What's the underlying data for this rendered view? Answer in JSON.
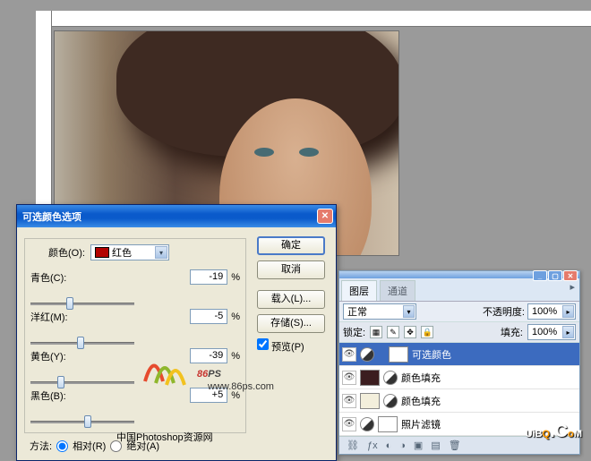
{
  "dialog": {
    "title": "可选颜色选项",
    "color_label": "颜色(O):",
    "color_name": "红色",
    "sliders": [
      {
        "label": "青色(C):",
        "value": "-19",
        "thumb": 40
      },
      {
        "label": "洋红(M):",
        "value": "-5",
        "thumb": 52
      },
      {
        "label": "黄色(Y):",
        "value": "-39",
        "thumb": 30
      },
      {
        "label": "黑色(B):",
        "value": "+5",
        "thumb": 60
      }
    ],
    "buttons": {
      "ok": "确定",
      "cancel": "取消",
      "load": "载入(L)...",
      "save": "存储(S)..."
    },
    "preview": "预览(P)",
    "method_label": "方法:",
    "method_rel": "相对(R)",
    "method_abs": "绝对(A)"
  },
  "layers": {
    "tab1": "图层",
    "tab2": "通道",
    "blend_label": "",
    "blend_value": "正常",
    "opacity_label": "不透明度:",
    "opacity_value": "100%",
    "lock_label": "锁定:",
    "fill_label": "填充:",
    "fill_value": "100%",
    "items": [
      {
        "name": "可选颜色",
        "sel": true,
        "thumb": "w",
        "adj": true
      },
      {
        "name": "颜色填充",
        "sel": false,
        "thumb": "dk",
        "adj": true
      },
      {
        "name": "颜色填充",
        "sel": false,
        "thumb": "lt",
        "adj": true
      },
      {
        "name": "照片滤镜",
        "sel": false,
        "thumb": "w",
        "adj": true
      }
    ]
  },
  "logo_text": "86",
  "logo_suffix": "PS",
  "logo_url": "www.86ps.com",
  "caption": "中国Photoshop资源网",
  "watermark_a": "UiB",
  "watermark_b": "Q",
  ".watermark_c": ".C",
  "watermark_d": "o",
  "watermark_e": "M"
}
